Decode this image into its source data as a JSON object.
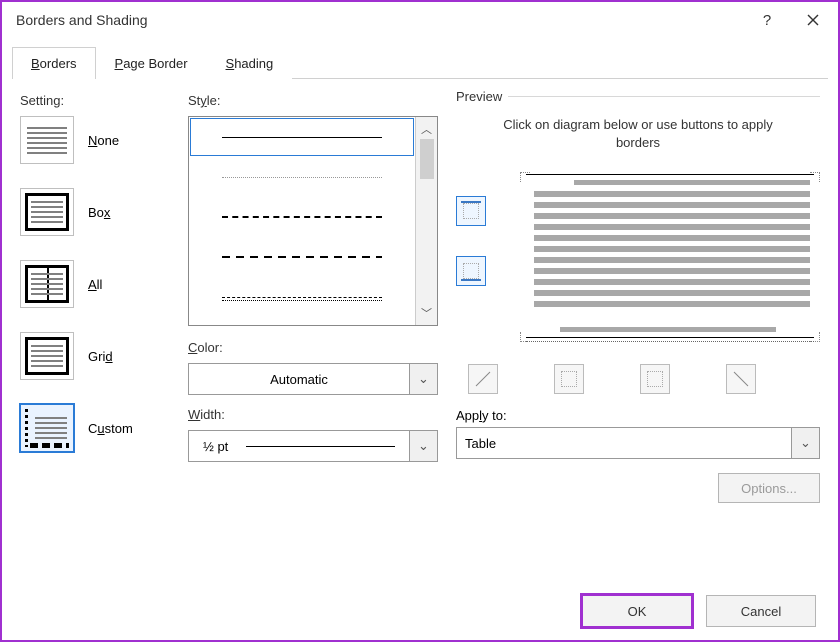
{
  "window": {
    "title": "Borders and Shading"
  },
  "tabs": {
    "borders": "Borders",
    "page_border": "Page Border",
    "shading": "Shading"
  },
  "settings": {
    "label": "Setting:",
    "items": [
      {
        "label": "None"
      },
      {
        "label": "Box"
      },
      {
        "label": "All"
      },
      {
        "label": "Grid"
      },
      {
        "label": "Custom"
      }
    ]
  },
  "style": {
    "label": "Style:",
    "color_label": "Color:",
    "color_value": "Automatic",
    "width_label": "Width:",
    "width_value": "½ pt"
  },
  "preview": {
    "label": "Preview",
    "instruction": "Click on diagram below or use buttons to apply borders",
    "apply_label": "Apply to:",
    "apply_value": "Table",
    "options_label": "Options..."
  },
  "footer": {
    "ok": "OK",
    "cancel": "Cancel"
  }
}
